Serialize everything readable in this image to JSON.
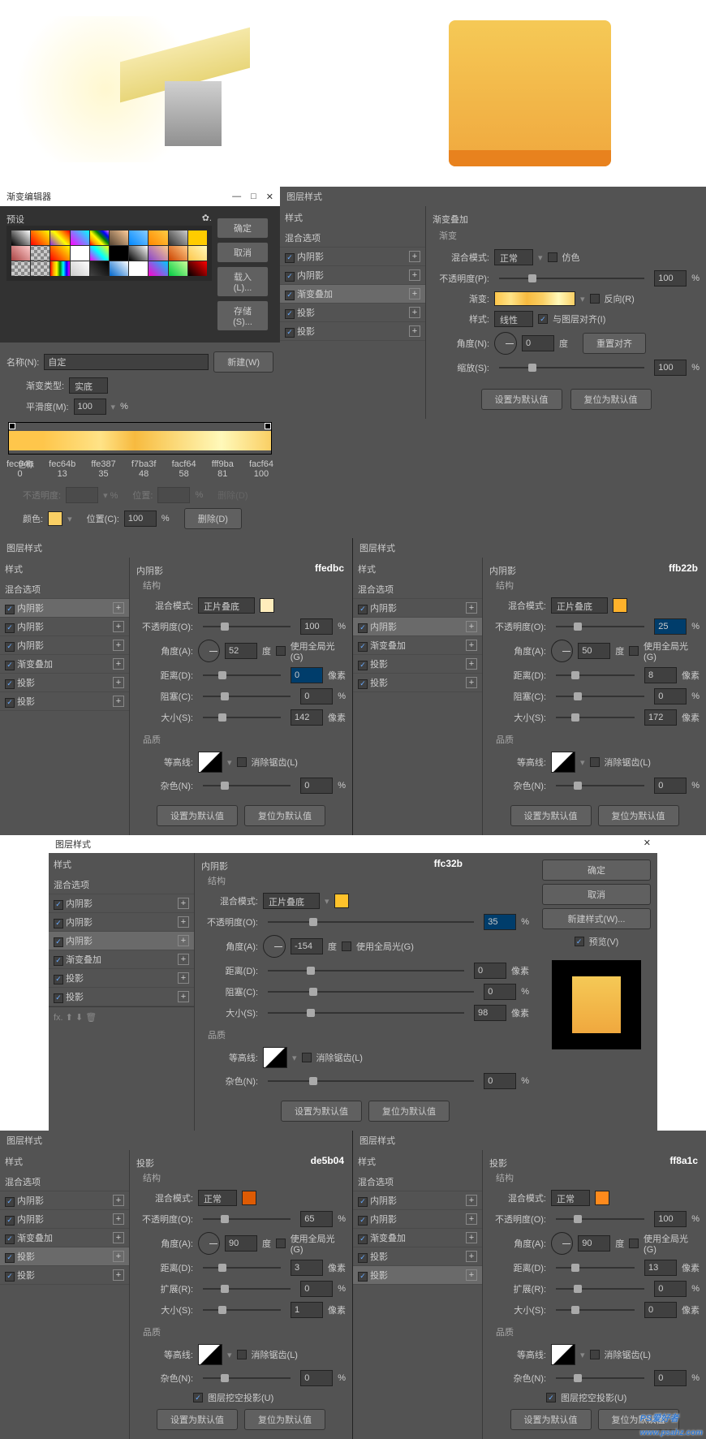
{
  "illustration": {
    "watermark_url": "www.psahz.com",
    "watermark_brand": "PS爱好者"
  },
  "gradientEditor": {
    "title": "渐变编辑器",
    "presets_label": "预设",
    "buttons": {
      "ok": "确定",
      "cancel": "取消",
      "load": "载入(L)...",
      "save": "存储(S)..."
    },
    "name_label": "名称(N):",
    "name_value": "自定",
    "new_btn": "新建(W)",
    "type_label": "渐变类型:",
    "type_value": "实底",
    "smooth_label": "平滑度(M):",
    "smooth_value": "100",
    "pct": "%",
    "stops": [
      {
        "hex": "fec64b",
        "pos": "0"
      },
      {
        "hex": "fec64b",
        "pos": "13"
      },
      {
        "hex": "ffe387",
        "pos": "35"
      },
      {
        "hex": "f7ba3f",
        "pos": "48"
      },
      {
        "hex": "facf64",
        "pos": "58"
      },
      {
        "hex": "fff9ba",
        "pos": "81"
      },
      {
        "hex": "facf64",
        "pos": "100"
      }
    ],
    "stop_label": "色标",
    "opacity_label": "不透明度:",
    "position_label": "位置:",
    "delete_btn": "删除(D)",
    "color_label": "颜色:",
    "pos_label": "位置(C):",
    "pos_value": "100"
  },
  "layerStyle": {
    "title": "图层样式",
    "styles_header": "样式",
    "blending": "混合选项",
    "items": [
      "内阴影",
      "内阴影",
      "渐变叠加",
      "投影",
      "投影"
    ]
  },
  "gradientOverlay": {
    "title": "渐变叠加",
    "sub": "渐变",
    "blend_label": "混合模式:",
    "blend_value": "正常",
    "dither": "仿色",
    "opacity_label": "不透明度(P):",
    "opacity_value": "100",
    "gradient_label": "渐变:",
    "reverse": "反向(R)",
    "style_label": "样式:",
    "style_value": "线性",
    "align": "与图层对齐(I)",
    "angle_label": "角度(N):",
    "angle_value": "0",
    "degree": "度",
    "reset_align": "重置对齐",
    "scale_label": "缩放(S):",
    "scale_value": "100",
    "default_btn": "设置为默认值",
    "reset_btn": "复位为默认值"
  },
  "innerShadow1": {
    "hex": "ffedbc",
    "title": "内阴影",
    "structure": "结构",
    "blend_label": "混合模式:",
    "blend_value": "正片叠底",
    "opacity_label": "不透明度(O):",
    "opacity_value": "100",
    "angle_label": "角度(A):",
    "angle_value": "52",
    "degree": "度",
    "global": "使用全局光(G)",
    "distance_label": "距离(D):",
    "distance_value": "0",
    "px": "像素",
    "choke_label": "阻塞(C):",
    "choke_value": "0",
    "size_label": "大小(S):",
    "size_value": "142",
    "quality": "品质",
    "contour_label": "等高线:",
    "antialias": "消除锯齿(L)",
    "noise_label": "杂色(N):",
    "noise_value": "0",
    "default_btn": "设置为默认值",
    "reset_btn": "复位为默认值"
  },
  "innerShadow2": {
    "hex": "ffb22b",
    "blend_value": "正片叠底",
    "opacity_value": "25",
    "angle_value": "50",
    "distance_value": "8",
    "choke_value": "0",
    "size_value": "172",
    "noise_value": "0"
  },
  "innerShadow3": {
    "hex": "ffc32b",
    "blend_value": "正片叠底",
    "opacity_value": "35",
    "angle_value": "-154",
    "distance_value": "0",
    "choke_value": "0",
    "size_value": "98",
    "noise_value": "0",
    "buttons": {
      "ok": "确定",
      "cancel": "取消",
      "new": "新建样式(W)...",
      "preview": "预览(V)"
    }
  },
  "dropShadow1": {
    "hex": "de5b04",
    "title": "投影",
    "blend_value": "正常",
    "opacity_value": "65",
    "angle_value": "90",
    "distance_value": "3",
    "spread_label": "扩展(R):",
    "spread_value": "0",
    "size_value": "1",
    "knockout": "图层挖空投影(U)"
  },
  "dropShadow2": {
    "hex": "ff8a1c",
    "blend_value": "正常",
    "opacity_value": "100",
    "angle_value": "90",
    "distance_value": "13",
    "spread_value": "0",
    "size_value": "0"
  },
  "styleList2": {
    "items": [
      "内阴影",
      "内阴影",
      "内阴影",
      "渐变叠加",
      "投影",
      "投影"
    ]
  },
  "styleList3": {
    "items": [
      "内阴影",
      "内阴影",
      "内阴影",
      "渐变叠加",
      "投影",
      "投影"
    ]
  },
  "styleList4": {
    "items": [
      "内阴影",
      "内阴影",
      "渐变叠加",
      "投影",
      "投影"
    ]
  },
  "styleList5": {
    "items": [
      "内阴影",
      "内阴影",
      "渐变叠加",
      "投影",
      "投影"
    ]
  }
}
